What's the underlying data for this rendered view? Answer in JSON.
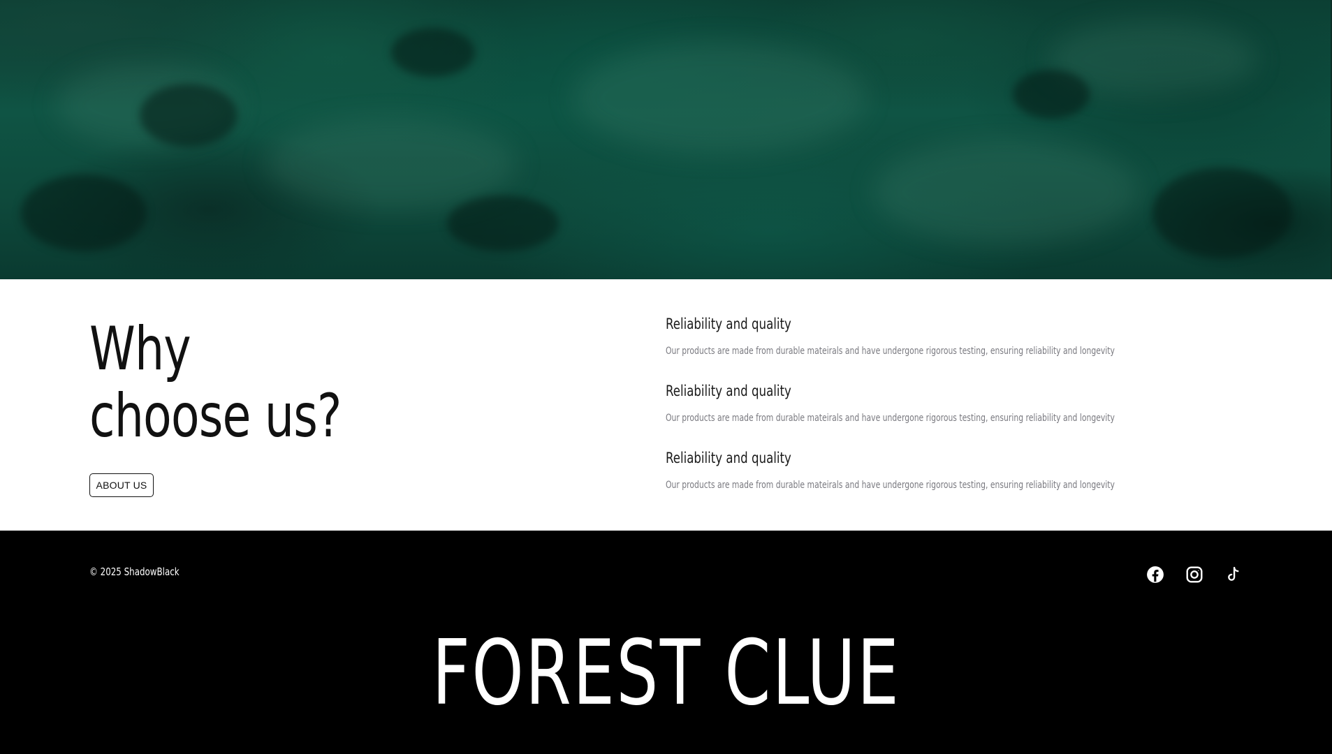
{
  "why": {
    "title_line1": "Why",
    "title_line2": "choose us?",
    "about_button": "ABOUT US",
    "features": [
      {
        "title": "Reliability and quality",
        "description": "Our products are made from durable mateirals and have undergone rigorous testing, ensuring reliability and longevity"
      },
      {
        "title": "Reliability and quality",
        "description": "Our products are made from durable mateirals and have undergone rigorous testing, ensuring reliability and longevity"
      },
      {
        "title": "Reliability and quality",
        "description": "Our products are made from durable mateirals and have undergone rigorous testing, ensuring reliability and longevity"
      }
    ]
  },
  "footer": {
    "copyright": "© 2025 ShadowBlack",
    "socials": [
      {
        "icon": "facebook-icon"
      },
      {
        "icon": "instagram-icon"
      },
      {
        "icon": "tiktok-icon"
      }
    ],
    "brand": "FOREST CLUE"
  },
  "colors": {
    "hero_green": "#0f5444",
    "footer_bg": "#000000",
    "text_dark": "#111111",
    "text_muted": "#7a7a80"
  }
}
